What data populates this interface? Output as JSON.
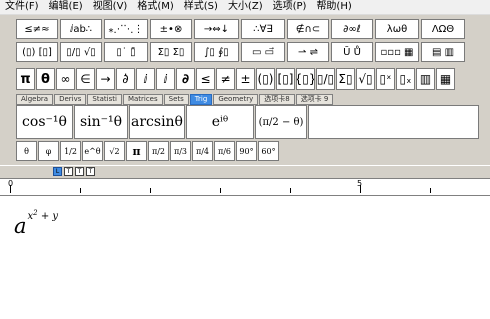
{
  "menu": [
    "文件(F)",
    "编辑(E)",
    "视图(V)",
    "格式(M)",
    "样式(S)",
    "大小(Z)",
    "选项(P)",
    "帮助(H)"
  ],
  "toolbar_row1": [
    "≤≠≈",
    "ⅈab∴",
    "⁎⋰⋱⋮",
    "±•⊗",
    "→⇔↓",
    "∴∀∃",
    "∉∩⊂",
    "∂∞ℓ",
    "λωθ",
    "ΛΩΘ"
  ],
  "toolbar_row2": [
    "(▯) [▯]",
    "▯/▯ √▯",
    "▯˙ ▯̄",
    "Σ▯ Σ▯",
    "∫▯ ∮▯",
    "▭ ▭⃗",
    "⇀ ⇌",
    "Ū Ů",
    "▫▫▫ ▦",
    "▤ ▥"
  ],
  "toolbar_row3": [
    "π",
    "θ",
    "∞",
    "∈",
    "→",
    "∂̇",
    "ⅈ",
    "ⅈ",
    "∂",
    "≤",
    "≠",
    "±",
    "(▯)",
    "[▯]",
    "{▯}",
    "▯/▯",
    "Σ▯",
    "√▯",
    "▯ˣ",
    "▯ₓ",
    "▥",
    "▦"
  ],
  "tabs": [
    "Algebra",
    "Derivs",
    "Statisti",
    "Matrices",
    "Sets",
    "Trig",
    "Geometry",
    "选项卡8",
    "选项卡 9"
  ],
  "active_tab": "Trig",
  "templates": {
    "arccos": "cos⁻¹θ",
    "arcsin_sup": "sin⁻¹θ",
    "arcsin": "arcsinθ",
    "exp": "eⁱᶿ",
    "paren": "(π/2 − θ)"
  },
  "small_row": [
    "θ",
    "φ",
    "1/2",
    "e^θ",
    "√2",
    "π",
    "π/2",
    "π/3",
    "π/4",
    "π/6",
    "90°",
    "60°"
  ],
  "align_buttons": [
    "L",
    "T",
    "T",
    "T"
  ],
  "ruler": {
    "label_0": "0",
    "label_5": "5"
  },
  "formula": {
    "base": "a",
    "exp": "x",
    "exp_sup": "2",
    "exp_rest": " + y"
  }
}
